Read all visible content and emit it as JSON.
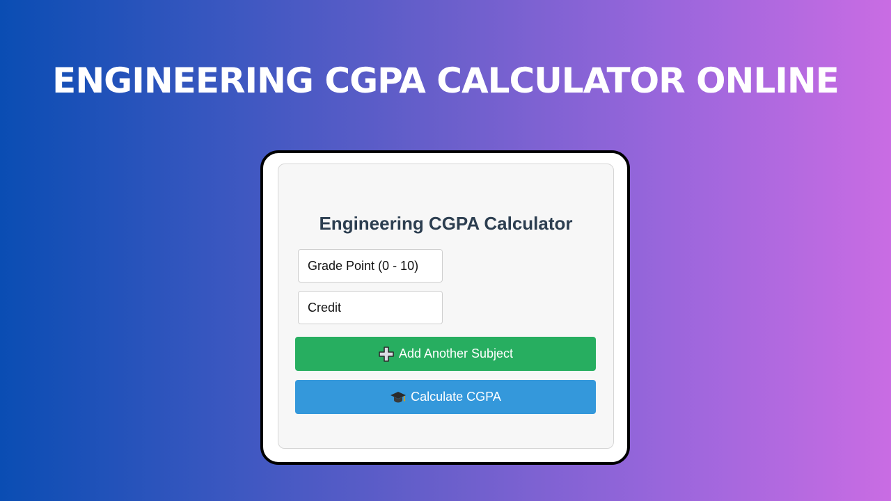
{
  "banner": {
    "title": "ENGINEERING CGPA CALCULATOR ONLINE"
  },
  "calculator": {
    "title": "Engineering CGPA Calculator",
    "grade_placeholder": "Grade Point (0 - 10)",
    "credit_placeholder": "Credit",
    "add_button_label": "Add Another Subject",
    "add_button_icon": "plus-icon",
    "calculate_button_label": "Calculate CGPA",
    "calculate_button_icon": "graduation-cap-icon"
  },
  "colors": {
    "gradient_start": "#0a4db3",
    "gradient_end": "#c96ce3",
    "add_button": "#27ae60",
    "calculate_button": "#3498db",
    "title_text": "#2c3e50"
  }
}
